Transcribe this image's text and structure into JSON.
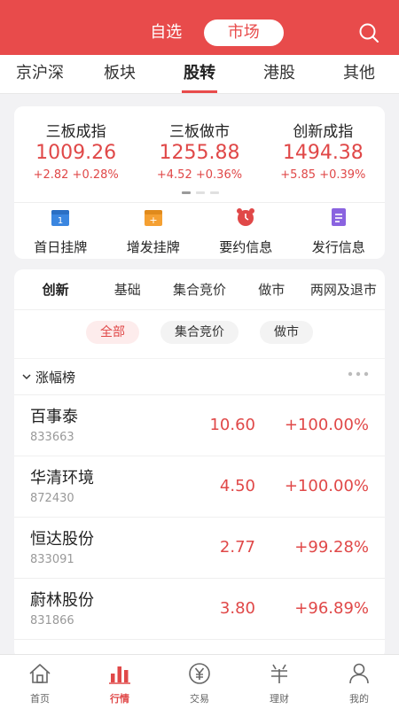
{
  "header": {
    "segments": [
      {
        "label": "自选"
      },
      {
        "label": "市场"
      }
    ]
  },
  "tabs": [
    {
      "label": "京沪深"
    },
    {
      "label": "板块"
    },
    {
      "label": "股转"
    },
    {
      "label": "港股"
    },
    {
      "label": "其他"
    }
  ],
  "indices": [
    {
      "name": "三板成指",
      "value": "1009.26",
      "change": "+2.82",
      "pct": "+0.28%"
    },
    {
      "name": "三板做市",
      "value": "1255.88",
      "change": "+4.52",
      "pct": "+0.36%"
    },
    {
      "name": "创新成指",
      "value": "1494.38",
      "change": "+5.85",
      "pct": "+0.39%"
    }
  ],
  "quick": [
    {
      "label": "首日挂牌",
      "icon": "calendar-icon",
      "color": "#3a86e0"
    },
    {
      "label": "增发挂牌",
      "icon": "calendar-plus-icon",
      "color": "#f5a032"
    },
    {
      "label": "要约信息",
      "icon": "alarm-clock-icon",
      "color": "#e04848"
    },
    {
      "label": "发行信息",
      "icon": "document-icon",
      "color": "#8a63e0"
    }
  ],
  "subtabs": [
    {
      "label": "创新"
    },
    {
      "label": "基础"
    },
    {
      "label": "集合竞价"
    },
    {
      "label": "做市"
    },
    {
      "label": "两网及退市"
    }
  ],
  "filters": [
    {
      "label": "全部"
    },
    {
      "label": "集合竞价"
    },
    {
      "label": "做市"
    }
  ],
  "section": {
    "title": "涨幅榜"
  },
  "stocks": [
    {
      "name": "百事泰",
      "code": "833663",
      "price": "10.60",
      "pct": "+100.00%"
    },
    {
      "name": "华清环境",
      "code": "872430",
      "price": "4.50",
      "pct": "+100.00%"
    },
    {
      "name": "恒达股份",
      "code": "833091",
      "price": "2.77",
      "pct": "+99.28%"
    },
    {
      "name": "蔚林股份",
      "code": "831866",
      "price": "3.80",
      "pct": "+96.89%"
    }
  ],
  "bottom_nav": [
    {
      "label": "首页",
      "icon": "home-icon"
    },
    {
      "label": "行情",
      "icon": "bar-chart-icon"
    },
    {
      "label": "交易",
      "icon": "yuan-coin-icon"
    },
    {
      "label": "理财",
      "icon": "finance-icon"
    },
    {
      "label": "我的",
      "icon": "user-icon"
    }
  ],
  "colors": {
    "accent": "#e84b4b",
    "up": "#e04848"
  }
}
